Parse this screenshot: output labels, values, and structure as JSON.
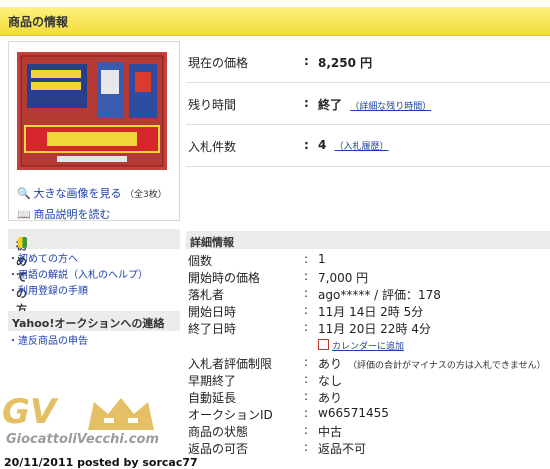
{
  "header": {
    "title": "商品の情報"
  },
  "photo_links": {
    "enlarge": "大きな画像を見る",
    "count": "（全3枚）",
    "description": "商品説明を読む"
  },
  "price_rows": [
    {
      "label": "現在の価格",
      "value": "8,250 円",
      "sub": ""
    },
    {
      "label": "残り時間",
      "value": "終了",
      "sub": "（詳細な残り時間）"
    },
    {
      "label": "入札件数",
      "value": "4",
      "sub": "（入札履歴）"
    }
  ],
  "beginner": {
    "title": "初めての方",
    "links": [
      "初めての方へ",
      "用語の解説（入札のヘルプ）",
      "利用登録の手順"
    ]
  },
  "contact": {
    "title": "Yahoo!オークションへの連絡",
    "links": [
      "違反商品の申告"
    ]
  },
  "details": {
    "title": "詳細情報",
    "rows": [
      {
        "key": "個数",
        "value": "1",
        "note": ""
      },
      {
        "key": "開始時の価格",
        "value": "7,000 円",
        "note": ""
      },
      {
        "key": "落札者",
        "value": "ago***** / 評価：178",
        "note": ""
      },
      {
        "key": "開始日時",
        "value": "11月 14日 2時 5分",
        "note": ""
      },
      {
        "key": "終了日時",
        "value": "11月 20日 22時 4分",
        "note": ""
      },
      {
        "key": "",
        "value": "カレンダーに追加",
        "note": ""
      },
      {
        "key": "入札者評価制限",
        "value": "あり",
        "note": "（評価の合計がマイナスの方は入札できません）"
      },
      {
        "key": "早期終了",
        "value": "なし",
        "note": ""
      },
      {
        "key": "自動延長",
        "value": "あり",
        "note": ""
      },
      {
        "key": "オークションID",
        "value": "w66571455",
        "note": ""
      },
      {
        "key": "商品の状態",
        "value": "中古",
        "note": ""
      },
      {
        "key": "返品の可否",
        "value": "返品不可",
        "note": ""
      }
    ]
  },
  "watermark": {
    "logo": "GV",
    "site": "GiocattoliVecchi.com",
    "credit": "20/11/2011 posted by sorcac77"
  }
}
